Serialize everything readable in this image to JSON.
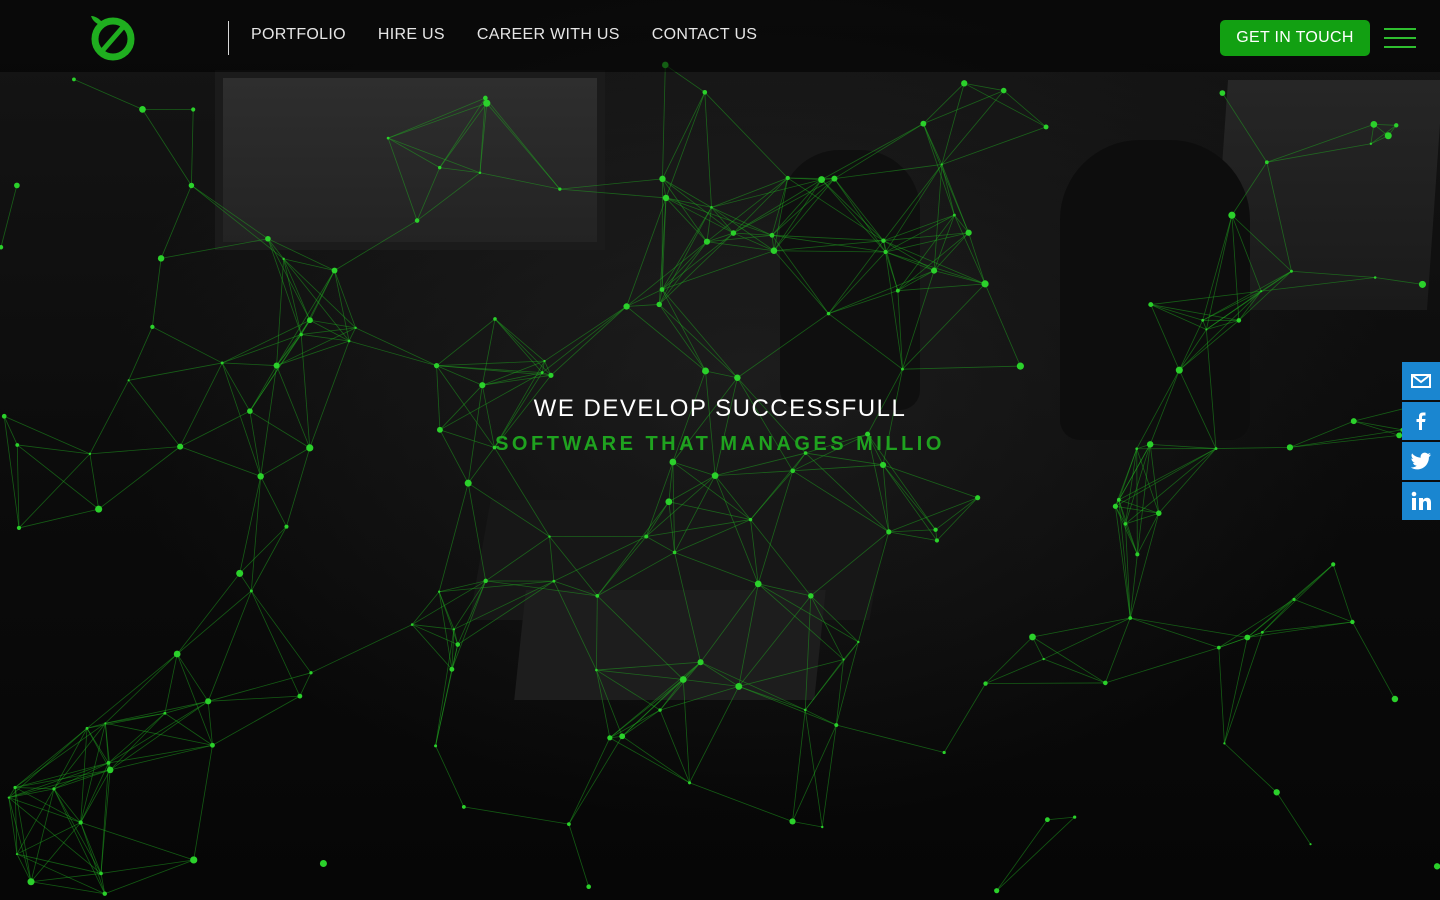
{
  "nav": {
    "items": [
      {
        "label": "PORTFOLIO"
      },
      {
        "label": "HIRE US"
      },
      {
        "label": "CAREER WITH US"
      },
      {
        "label": "CONTACT US"
      }
    ]
  },
  "cta_label": "GET IN TOUCH",
  "hero": {
    "title": "WE DEVELOP SUCCESSFULL",
    "subtitle": "SOFTWARE THAT MANAGES MILLIO"
  },
  "social": [
    "mail-icon",
    "facebook-icon",
    "twitter-icon",
    "linkedin-icon"
  ],
  "colors": {
    "accent": "#12a012",
    "network": "#2bd12b",
    "social": "#1a86d0",
    "header": "#000000"
  }
}
